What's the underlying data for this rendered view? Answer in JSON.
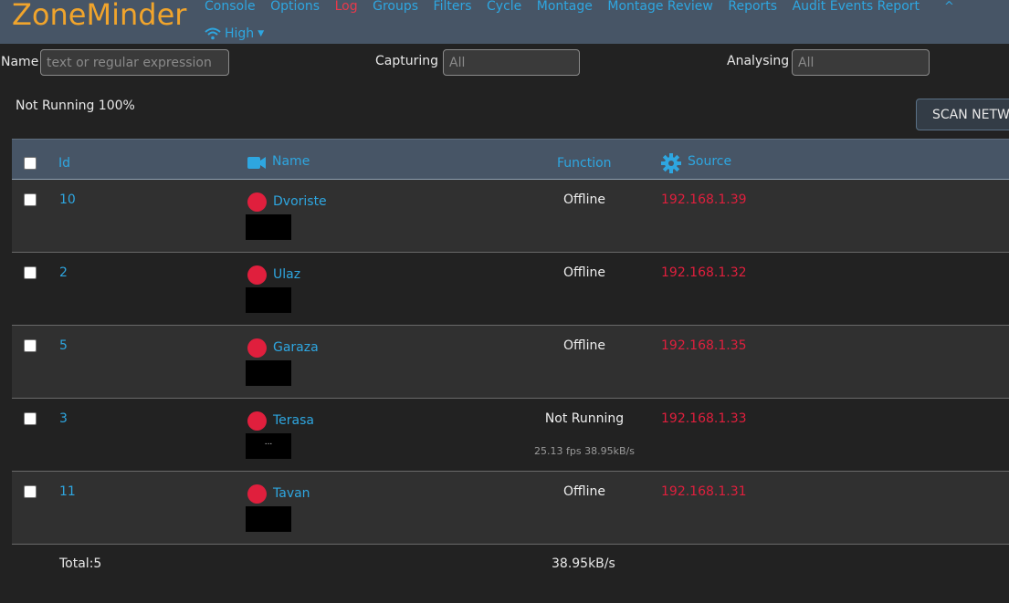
{
  "navbar": {
    "brand": "ZoneMinder",
    "items": [
      "Console",
      "Options",
      "Log",
      "Groups",
      "Filters",
      "Cycle",
      "Montage",
      "Montage Review",
      "Reports",
      "Audit Events Report"
    ],
    "bandwidth": "High"
  },
  "filters": {
    "name_label": "Name",
    "name_placeholder": "text or regular expression",
    "capturing_label": "Capturing",
    "capturing_value": "All",
    "analysing_label": "Analysing",
    "analysing_value": "All"
  },
  "status_text": "Not Running 100%",
  "scan_button": "SCAN NETWORK",
  "table": {
    "headers": {
      "id": "Id",
      "name": "Name",
      "function": "Function",
      "source": "Source"
    },
    "rows": [
      {
        "id": "10",
        "name": "Dvoriste",
        "function": "Offline",
        "source": "192.168.1.39",
        "fps": "",
        "thumb": ""
      },
      {
        "id": "2",
        "name": "Ulaz",
        "function": "Offline",
        "source": "192.168.1.32",
        "fps": "",
        "thumb": ""
      },
      {
        "id": "5",
        "name": "Garaza",
        "function": "Offline",
        "source": "192.168.1.35",
        "fps": "",
        "thumb": ""
      },
      {
        "id": "3",
        "name": "Terasa",
        "function": "Not Running",
        "source": "192.168.1.33",
        "fps": "25.13 fps 38.95kB/s",
        "thumb": "..."
      },
      {
        "id": "11",
        "name": "Tavan",
        "function": "Offline",
        "source": "192.168.1.31",
        "fps": "",
        "thumb": ""
      }
    ],
    "footer": {
      "total": "Total:5",
      "bandwidth": "38.95kB/s"
    }
  },
  "colors": {
    "accent": "#2ea6e0",
    "brand": "#f0a42c",
    "error": "#e01f3d",
    "navbar": "#475566"
  }
}
